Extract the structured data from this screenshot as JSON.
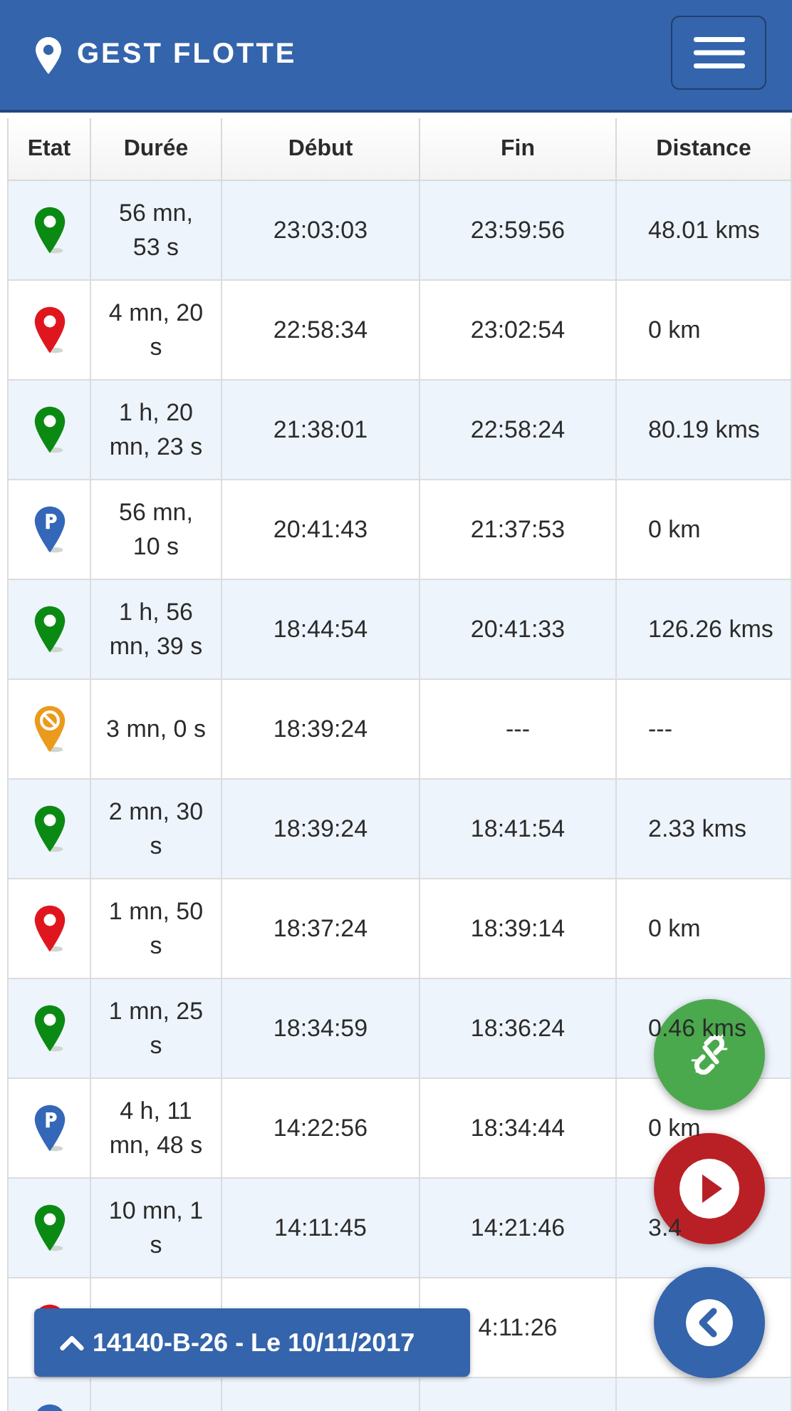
{
  "header": {
    "title": "GEST FLOTTE"
  },
  "table": {
    "columns": [
      "Etat",
      "Durée",
      "Début",
      "Fin",
      "Distance"
    ],
    "rows": [
      {
        "kind": "moving",
        "duree": "56 mn, 53 s",
        "debut": "23:03:03",
        "fin": "23:59:56",
        "distance": "48.01 kms"
      },
      {
        "kind": "stop",
        "duree": "4 mn, 20 s",
        "debut": "22:58:34",
        "fin": "23:02:54",
        "distance": "0 km"
      },
      {
        "kind": "moving",
        "duree": "1 h, 20 mn, 23 s",
        "debut": "21:38:01",
        "fin": "22:58:24",
        "distance": "80.19 kms"
      },
      {
        "kind": "parking",
        "duree": "56 mn, 10 s",
        "debut": "20:41:43",
        "fin": "21:37:53",
        "distance": "0 km"
      },
      {
        "kind": "moving",
        "duree": "1 h, 56 mn, 39 s",
        "debut": "18:44:54",
        "fin": "20:41:33",
        "distance": "126.26 kms"
      },
      {
        "kind": "idle",
        "duree": "3 mn, 0 s",
        "debut": "18:39:24",
        "fin": "---",
        "distance": "---"
      },
      {
        "kind": "moving",
        "duree": "2 mn, 30 s",
        "debut": "18:39:24",
        "fin": "18:41:54",
        "distance": "2.33 kms"
      },
      {
        "kind": "stop",
        "duree": "1 mn, 50 s",
        "debut": "18:37:24",
        "fin": "18:39:14",
        "distance": "0 km"
      },
      {
        "kind": "moving",
        "duree": "1 mn, 25 s",
        "debut": "18:34:59",
        "fin": "18:36:24",
        "distance": "0.46 kms"
      },
      {
        "kind": "parking",
        "duree": "4 h, 11 mn, 48 s",
        "debut": "14:22:56",
        "fin": "18:34:44",
        "distance": "0 km"
      },
      {
        "kind": "moving",
        "duree": "10 mn, 1 s",
        "debut": "14:11:45",
        "fin": "14:21:46",
        "distance": "3.4"
      },
      {
        "kind": "stop",
        "fin": "4:11:26"
      },
      {
        "kind": "parking"
      }
    ]
  },
  "fabs": [
    {
      "kind": "unlink"
    },
    {
      "kind": "play"
    },
    {
      "kind": "back"
    }
  ],
  "badge": {
    "text": "14140-B-26 - Le 10/11/2017"
  }
}
